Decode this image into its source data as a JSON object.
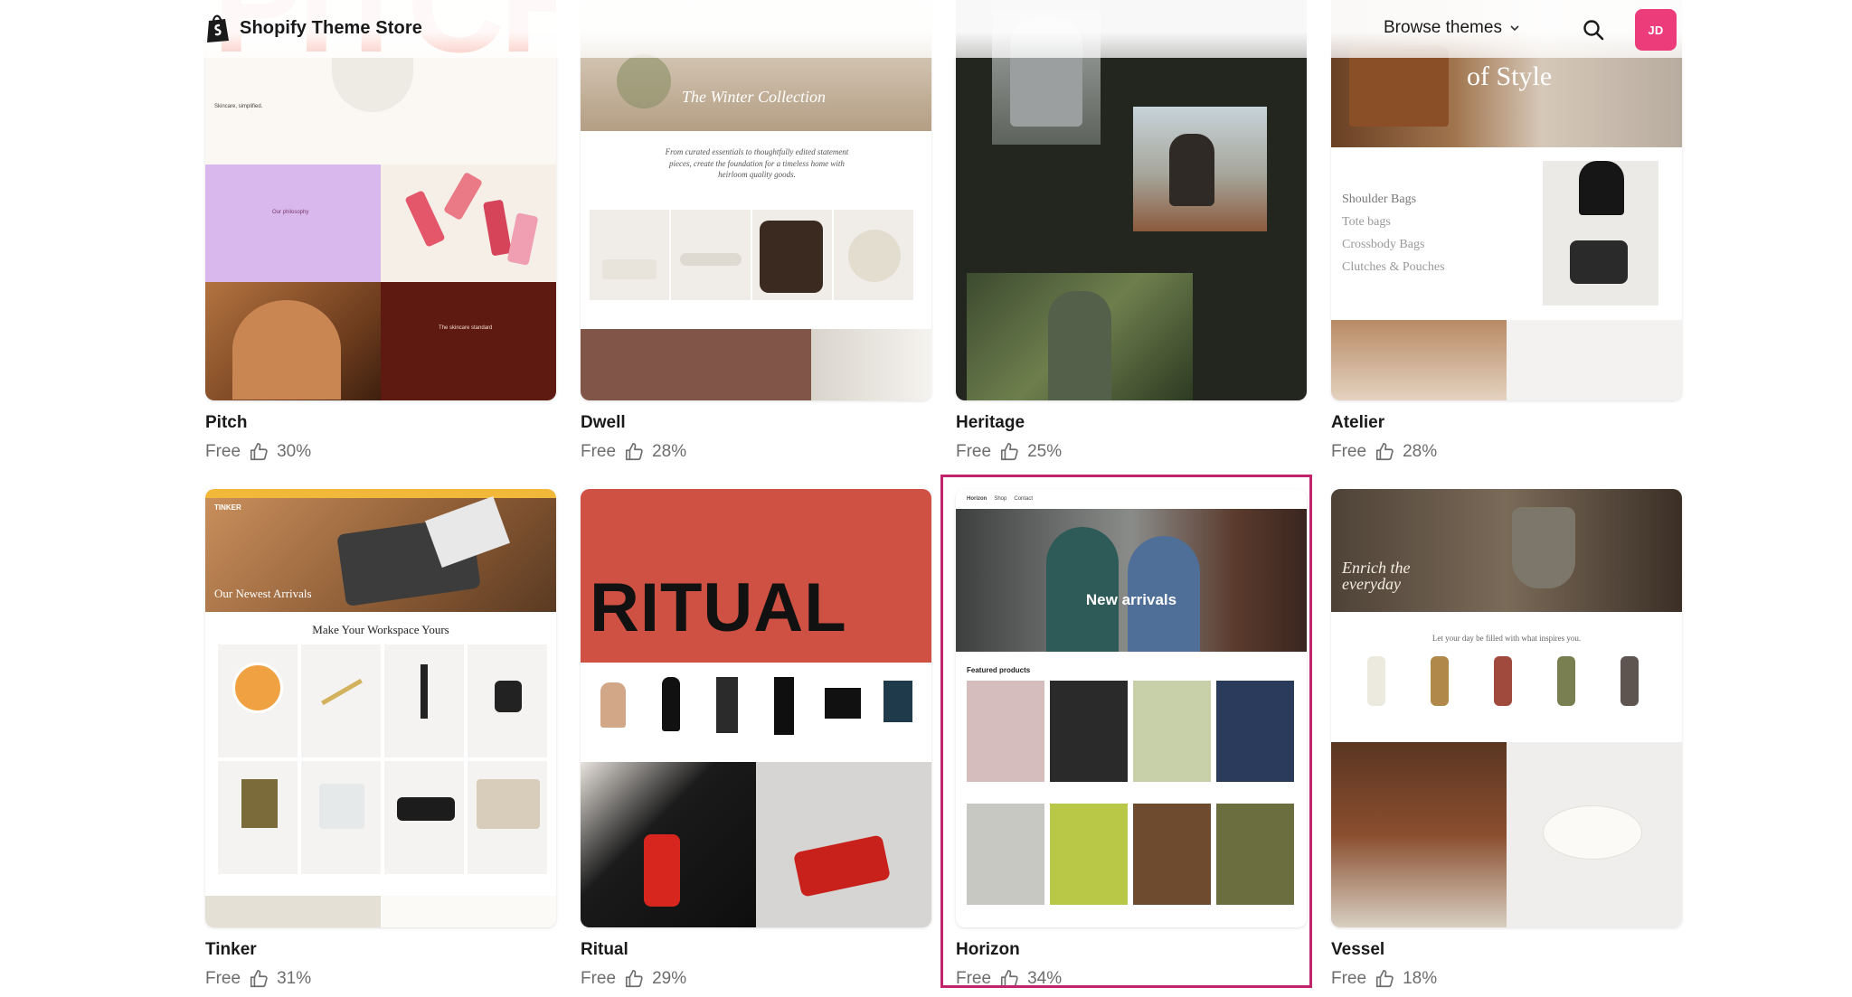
{
  "header": {
    "brand": "Shopify Theme Store",
    "browse_label": "Browse themes",
    "avatar_initials": "JD"
  },
  "themes": [
    {
      "name": "Pitch",
      "price": "Free",
      "rating": "30%"
    },
    {
      "name": "Dwell",
      "price": "Free",
      "rating": "28%"
    },
    {
      "name": "Heritage",
      "price": "Free",
      "rating": "25%"
    },
    {
      "name": "Atelier",
      "price": "Free",
      "rating": "28%"
    },
    {
      "name": "Tinker",
      "price": "Free",
      "rating": "31%"
    },
    {
      "name": "Ritual",
      "price": "Free",
      "rating": "29%"
    },
    {
      "name": "Horizon",
      "price": "Free",
      "rating": "34%"
    },
    {
      "name": "Vessel",
      "price": "Free",
      "rating": "18%"
    }
  ],
  "previews": {
    "pitch": {
      "wordmark": "PITCH",
      "tagline": "Skincare, simplified.",
      "philosophy": "Our philosophy",
      "standard": "The skincare standard"
    },
    "dwell": {
      "hero": "The Winter Collection",
      "intro": "From curated essentials to thoughtfully edited statement pieces, create the foundation for a timeless home with heirloom quality goods."
    },
    "atelier": {
      "hero": "of Style",
      "categories": [
        "Shoulder Bags",
        "Tote bags",
        "Crossbody Bags",
        "Clutches & Pouches"
      ]
    },
    "tinker": {
      "logo": "TINKER",
      "hero": "Our Newest Arrivals",
      "section": "Make Your Workspace Yours"
    },
    "ritual": {
      "wordmark": "RITUAL"
    },
    "horizon": {
      "hero": "New arrivals",
      "section": "Featured products",
      "nav": [
        "Horizon",
        "Shop",
        "Contact"
      ]
    },
    "vessel": {
      "hero": "Enrich the everyday",
      "sub": "Let your day be filled with what inspires you."
    }
  },
  "colors": {
    "accent": "#c0246b",
    "avatar": "#ec3d7a",
    "ritual_red": "#cf5144",
    "pitch_red": "#ef3c1d"
  }
}
